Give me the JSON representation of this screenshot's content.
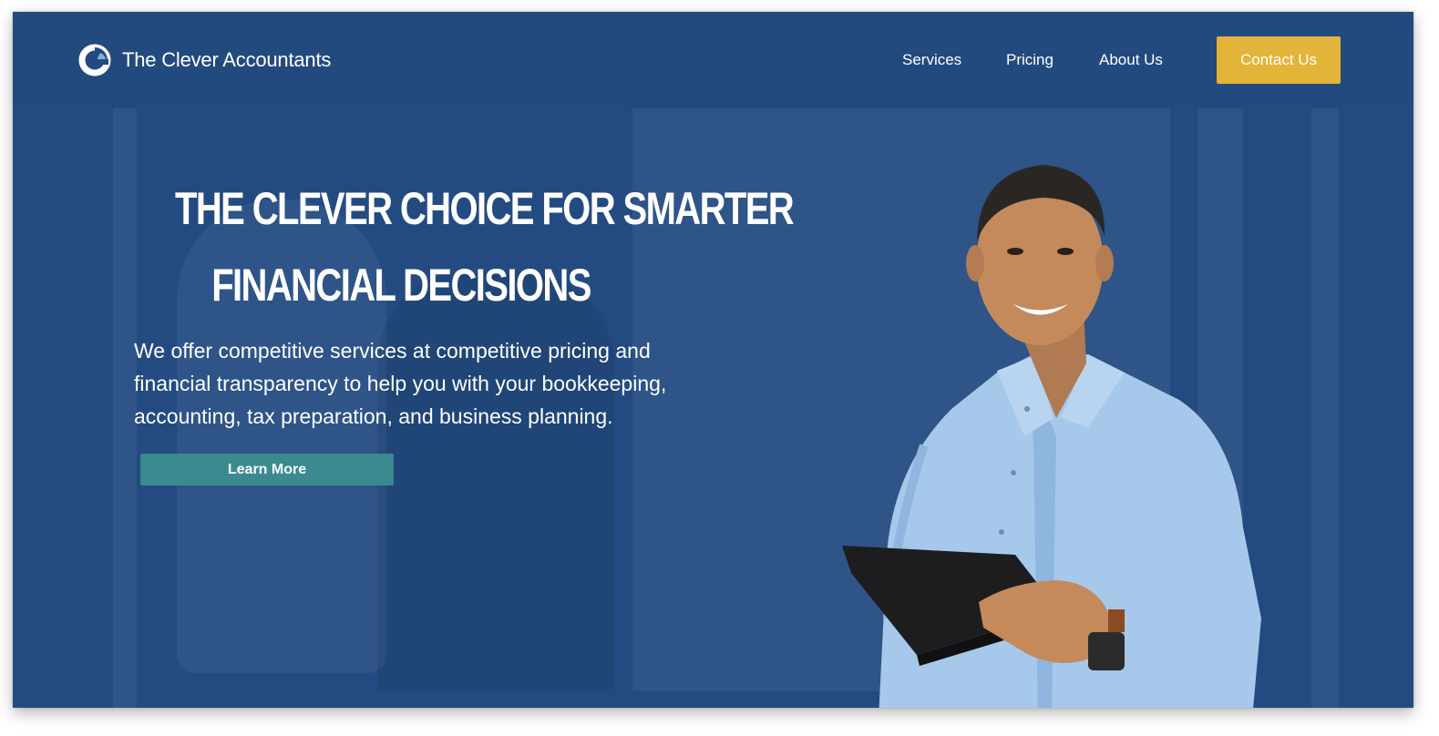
{
  "header": {
    "brand": "The Clever Accountants",
    "nav": [
      {
        "label": "Services"
      },
      {
        "label": "Pricing"
      },
      {
        "label": "About Us"
      }
    ],
    "contact_label": "Contact Us"
  },
  "hero": {
    "headline_line1": "The Clever Choice for Smarter",
    "headline_line2": "Financial Decisions",
    "description": "We offer competitive services at competitive pricing and financial transparency to help you with your bookkeeping, accounting, tax preparation, and business planning.",
    "cta_label": "Learn More"
  },
  "colors": {
    "background": "#234a80",
    "accent": "#e2b43a",
    "cta": "#3a8a8f"
  },
  "icons": [
    "logo-icon"
  ]
}
